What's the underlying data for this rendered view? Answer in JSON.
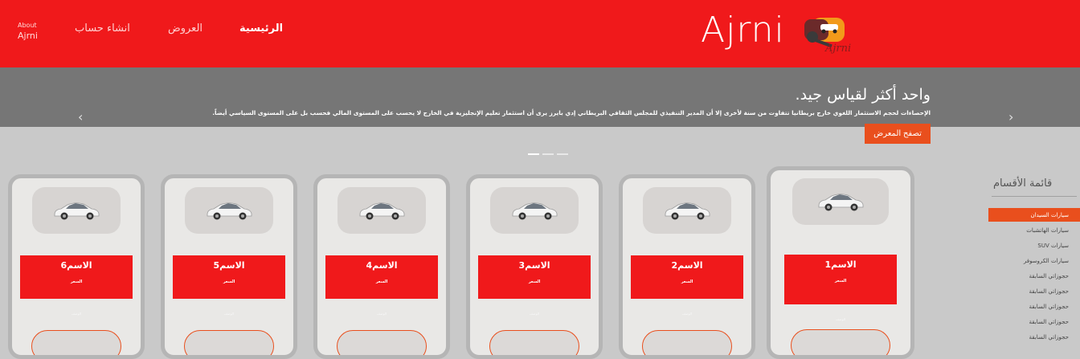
{
  "header": {
    "about_line1": "About",
    "about_line2": "Ajrni",
    "nav": [
      "الرئيسية",
      "العروض",
      "انشاء حساب"
    ],
    "brand": "Ajrni",
    "logo_text": "Ajrni"
  },
  "hero": {
    "title": "واحد أكثر لقياس جيد.",
    "description": "الإحصاءات لحجم الاستثمار اللغوي خارج بريطانيا تتفاوت من سنة لأخرى إلا أن المدير التنفيذي للمجلس الثقافي البريطاني إدي بايرز يرى أن استثمار تعليم الإنجليزية في الخارج لا يحسب على المستوى المالي فحسب بل على المستوى السياسي أيضاً.",
    "button": "تصفح المعرض",
    "prev_icon": "chevron-left-icon",
    "next_icon": "chevron-right-icon",
    "indicator_active": 0,
    "indicator_count": 3
  },
  "sidebar": {
    "title": "قائمة الأقسام",
    "items": [
      "سيارات السيدان",
      "سيارات الهاتشبات",
      "سيارات SUV",
      "سيارات الكروسوفر",
      "حجوزاتي السابقة",
      "حجوزاتي السابقة",
      "حجوزاتي السابقة",
      "حجوزاتي السابقة",
      "حجوزاتي السابقة"
    ],
    "active_index": 0
  },
  "cards": [
    {
      "name": "الاسم1",
      "price": "السعر",
      "desc": "الوصف",
      "image_icon": "car-icon"
    },
    {
      "name": "الاسم2",
      "price": "السعر",
      "desc": "الوصف",
      "image_icon": "car-icon"
    },
    {
      "name": "الاسم3",
      "price": "السعر",
      "desc": "الوصف",
      "image_icon": "car-icon"
    },
    {
      "name": "الاسم4",
      "price": "السعر",
      "desc": "الوصف",
      "image_icon": "car-icon"
    },
    {
      "name": "الاسم5",
      "price": "السعر",
      "desc": "الوصف",
      "image_icon": "car-icon"
    },
    {
      "name": "الاسم6",
      "price": "السعر",
      "desc": "الوصف",
      "image_icon": "car-icon"
    }
  ],
  "colors": {
    "primary": "#f0191b",
    "accent": "#e94f1d",
    "hero": "#767676",
    "background": "#c9c9c9"
  }
}
